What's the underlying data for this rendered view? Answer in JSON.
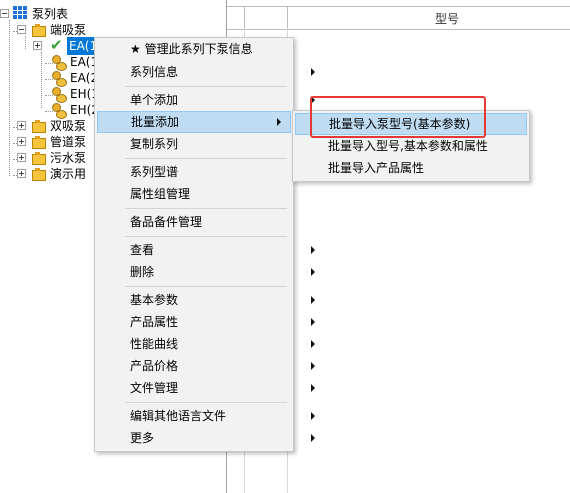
{
  "tree": {
    "root": {
      "label": "泵列表",
      "icon": "grid-icon"
    },
    "items": [
      {
        "label": "端吸泵",
        "icon": "folder-icon"
      },
      {
        "label": "EA(1",
        "icon": "check-icon"
      },
      {
        "label": "EA(1",
        "icon": "keys-icon"
      },
      {
        "label": "EA(2",
        "icon": "keys-icon"
      },
      {
        "label": "EH(1",
        "icon": "keys-icon"
      },
      {
        "label": "EH(2",
        "icon": "keys-icon"
      },
      {
        "label": "双吸泵",
        "icon": "folder-icon"
      },
      {
        "label": "管道泵",
        "icon": "folder-icon"
      },
      {
        "label": "污水泵",
        "icon": "folder-icon"
      },
      {
        "label": "演示用",
        "icon": "folder-icon"
      }
    ]
  },
  "grid": {
    "header": {
      "model": "型号"
    }
  },
  "context_menu": {
    "items": [
      {
        "label": "★ 管理此系列下泵信息",
        "submenu": false
      },
      {
        "label": "系列信息",
        "submenu": true
      },
      {
        "label": "单个添加",
        "submenu": true
      },
      {
        "label": "批量添加",
        "submenu": true,
        "highlighted": true
      },
      {
        "label": "复制系列",
        "submenu": true
      },
      {
        "label": "系列型谱",
        "submenu": false
      },
      {
        "label": "属性组管理",
        "submenu": false
      },
      {
        "label": "备品备件管理",
        "submenu": false
      },
      {
        "label": "查看",
        "submenu": true
      },
      {
        "label": "删除",
        "submenu": true
      },
      {
        "label": "基本参数",
        "submenu": true
      },
      {
        "label": "产品属性",
        "submenu": true
      },
      {
        "label": "性能曲线",
        "submenu": true
      },
      {
        "label": "产品价格",
        "submenu": true
      },
      {
        "label": "文件管理",
        "submenu": true
      },
      {
        "label": "编辑其他语言文件",
        "submenu": true
      },
      {
        "label": "更多",
        "submenu": true
      }
    ]
  },
  "submenu": {
    "items": [
      {
        "label": "批量导入泵型号(基本参数)",
        "highlighted": true
      },
      {
        "label": "批量导入型号,基本参数和属性"
      },
      {
        "label": "批量导入产品属性"
      }
    ]
  },
  "colors": {
    "selection": "#0078d7",
    "menu_highlight": "#c0dcf3",
    "annotation_box": "#e53935"
  }
}
